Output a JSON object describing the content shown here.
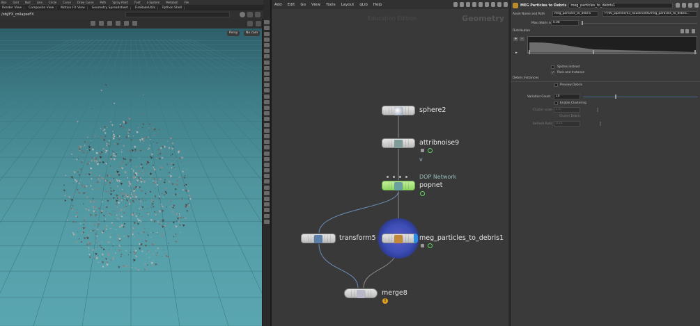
{
  "shelf": {
    "items": [
      "Box",
      "Grid",
      "Null",
      "Line",
      "Circle",
      "Curve",
      "Draw Curve",
      "Path",
      "Spray Paint",
      "Font",
      "L-System",
      "Metaball",
      "File"
    ]
  },
  "viewer_tabs": [
    "Render View",
    "Composite View",
    "Motion FX View",
    "Geometry Spreadsheet",
    "FireBakeUtils",
    "Python Shell"
  ],
  "viewer": {
    "path": "/obj/FX_collapseFX",
    "persp_label": "Persp",
    "cam_label": "No cam",
    "background_color": "#4f949d",
    "grid_color": "#3f7a83"
  },
  "network": {
    "menu": [
      "Add",
      "Edit",
      "Go",
      "View",
      "Tools",
      "Layout",
      "qLib",
      "Help"
    ],
    "watermark": "Education Edition",
    "context_label": "Geometry",
    "nodes": {
      "sphere": {
        "name": "sphere2"
      },
      "attribnoise": {
        "name": "attribnoise9",
        "sub": "v"
      },
      "popnet": {
        "name": "popnet",
        "comment": "DOP Network"
      },
      "transform": {
        "name": "transform5"
      },
      "meg": {
        "name": "meg_particles_to_debris1"
      },
      "merge": {
        "name": "merge8"
      }
    },
    "colors": {
      "wire_up": "#6a8fb8",
      "wire": "#8a8a8a",
      "popnet_green": "#9ae070",
      "display_flag": "#2c8fe0",
      "warning": "#e3a21a"
    }
  },
  "params": {
    "node_type": "MEG Particles to Debris",
    "node_name": "meg_particles_to_debris1",
    "asset_label": "Asset Name and Path",
    "asset_name": "meg_particles_to_debris",
    "asset_path": "P:/00_pipeline/03_houdini/otls/meg_particles_to_debris...",
    "max_debris_scale_label": "Max debris scale",
    "max_debris_scale": "0.08",
    "distribution_label": "Distribution",
    "sprites_instead_label": "Sprites instead",
    "pack_and_instance_label": "Pack and Instance",
    "debris_instances_label": "Debris Instances",
    "preview_debris_label": "Preview Debris",
    "variation_count_label": "Variation Count",
    "variation_count": "10",
    "enable_clustering_label": "Enable Clustering",
    "cluster_scale_label": "Cluster scale",
    "cluster_scale": "1.5",
    "cluster_debris_label": "Cluster Debris",
    "refresh_ratio_label": "Refresh Ratio",
    "refresh_ratio": "0.25",
    "sprites_instead": false,
    "pack_and_instance": true,
    "preview_debris": false,
    "enable_clustering": false
  }
}
